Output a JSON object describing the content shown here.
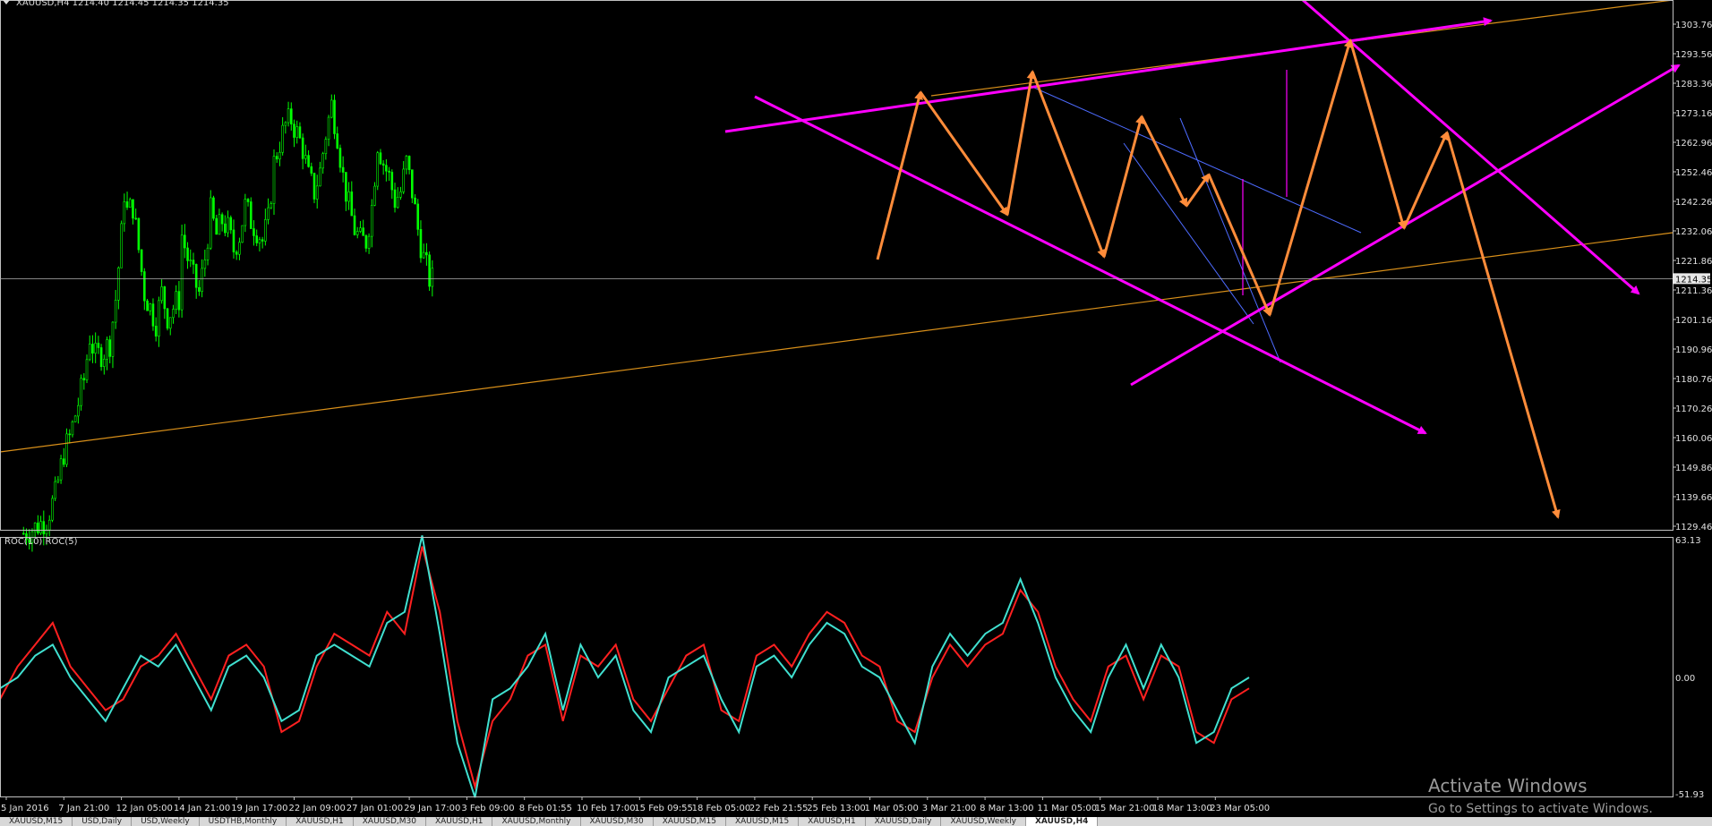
{
  "main_panel": {
    "header": "XAUUSD,H4  1214.40 1214.45 1214.35 1214.35",
    "price_ticks": [
      "1303.76",
      "1293.56",
      "1283.36",
      "1273.16",
      "1262.96",
      "1252.46",
      "1242.26",
      "1232.06",
      "1221.86",
      "1211.36",
      "1201.16",
      "1190.96",
      "1180.76",
      "1170.26",
      "1160.06",
      "1149.86",
      "1139.66",
      "1129.46"
    ],
    "current_price_label": "1214.35"
  },
  "indicator_panel": {
    "header": "ROC(10)  ROC(5)",
    "ticks": [
      "63.13",
      "0.00",
      "-51.93"
    ]
  },
  "time_axis": [
    "5 Jan 2016",
    "7 Jan 21:00",
    "12 Jan 05:00",
    "14 Jan 21:00",
    "19 Jan 17:00",
    "22 Jan 09:00",
    "27 Jan 01:00",
    "29 Jan 17:00",
    "3 Feb 09:00",
    "8 Feb 01:55",
    "10 Feb 17:00",
    "15 Feb 09:55",
    "18 Feb 05:00",
    "22 Feb 21:55",
    "25 Feb 13:00",
    "1 Mar 05:00",
    "3 Mar 21:00",
    "8 Mar 13:00",
    "11 Mar 05:00",
    "15 Mar 21:00",
    "18 Mar 13:00",
    "23 Mar 05:00"
  ],
  "colors": {
    "candle": "#00ff00",
    "channel": "#ff00ff",
    "zigzag": "#ff8c3a",
    "trendline": "#d9901a",
    "bluelines": "#4d6bff",
    "roc10": "#ff2020",
    "roc5": "#40e0d0"
  },
  "tabs": [
    "XAUUSD,M15",
    "USD,Daily",
    "USD,Weekly",
    "USDTHB,Monthly",
    "XAUUSD,H1",
    "XAUUSD,M30",
    "XAUUSD,H1",
    "XAUUSD,Monthly",
    "XAUUSD,M30",
    "XAUUSD,M15",
    "XAUUSD,M15",
    "XAUUSD,H1",
    "XAUUSD,Daily",
    "XAUUSD,Weekly",
    "XAUUSD,H4"
  ],
  "watermark": {
    "line1": "Activate Windows",
    "line2": "Go to Settings to activate Windows."
  },
  "chart_data": [
    {
      "type": "candlestick",
      "title": "XAUUSD,H4",
      "ylim": [
        1129.46,
        1308.0
      ],
      "x": [
        "5 Jan 2016",
        "7 Jan 21:00",
        "12 Jan 05:00",
        "14 Jan 21:00",
        "19 Jan 17:00",
        "22 Jan 09:00",
        "27 Jan 01:00",
        "29 Jan 17:00",
        "3 Feb 09:00",
        "8 Feb 01:55",
        "10 Feb 17:00",
        "15 Feb 09:55",
        "18 Feb 05:00",
        "22 Feb 21:55",
        "25 Feb 13:00",
        "1 Mar 05:00",
        "3 Mar 21:00",
        "8 Mar 13:00",
        "11 Mar 05:00",
        "15 Mar 21:00",
        "18 Mar 13:00",
        "23 Mar 05:00"
      ],
      "close_path": [
        [
          0.3,
          1127
        ],
        [
          0.5,
          1129
        ],
        [
          0.7,
          1132
        ],
        [
          0.85,
          1140
        ],
        [
          1.0,
          1155
        ],
        [
          1.1,
          1160
        ],
        [
          1.2,
          1168
        ],
        [
          1.35,
          1180
        ],
        [
          1.45,
          1195
        ],
        [
          1.55,
          1188
        ],
        [
          1.7,
          1190
        ],
        [
          1.8,
          1193
        ],
        [
          1.9,
          1208
        ],
        [
          2.0,
          1230
        ],
        [
          2.05,
          1245
        ],
        [
          2.1,
          1238
        ],
        [
          2.2,
          1240
        ],
        [
          2.3,
          1225
        ],
        [
          2.4,
          1210
        ],
        [
          2.5,
          1205
        ],
        [
          2.6,
          1200
        ],
        [
          2.7,
          1210
        ],
        [
          2.8,
          1202
        ],
        [
          2.9,
          1205
        ],
        [
          3.0,
          1208
        ],
        [
          3.05,
          1230
        ],
        [
          3.15,
          1222
        ],
        [
          3.25,
          1215
        ],
        [
          3.35,
          1210
        ],
        [
          3.45,
          1222
        ],
        [
          3.55,
          1238
        ],
        [
          3.65,
          1230
        ],
        [
          3.75,
          1235
        ],
        [
          3.85,
          1232
        ],
        [
          3.95,
          1225
        ],
        [
          4.05,
          1230
        ],
        [
          4.15,
          1240
        ],
        [
          4.25,
          1235
        ],
        [
          4.35,
          1232
        ],
        [
          4.45,
          1228
        ],
        [
          4.55,
          1235
        ],
        [
          4.65,
          1255
        ],
        [
          4.75,
          1262
        ],
        [
          4.85,
          1268
        ],
        [
          4.95,
          1270
        ],
        [
          5.05,
          1265
        ],
        [
          5.15,
          1260
        ],
        [
          5.25,
          1250
        ],
        [
          5.35,
          1245
        ],
        [
          5.45,
          1252
        ],
        [
          5.55,
          1265
        ],
        [
          5.65,
          1275
        ],
        [
          5.75,
          1265
        ],
        [
          5.85,
          1250
        ],
        [
          5.95,
          1240
        ],
        [
          6.05,
          1232
        ],
        [
          6.15,
          1228
        ],
        [
          6.25,
          1228
        ],
        [
          6.35,
          1240
        ],
        [
          6.45,
          1262
        ],
        [
          6.55,
          1255
        ],
        [
          6.65,
          1250
        ],
        [
          6.75,
          1242
        ],
        [
          6.85,
          1245
        ],
        [
          6.95,
          1255
        ],
        [
          7.05,
          1245
        ],
        [
          7.15,
          1232
        ],
        [
          7.25,
          1222
        ],
        [
          7.35,
          1215
        ],
        [
          7.45,
          1214
        ]
      ],
      "series": [
        {
          "name": "ROC(10)",
          "values": [
            -10,
            5,
            15,
            25,
            5,
            -5,
            -15,
            -10,
            5,
            10,
            20,
            5,
            -10,
            10,
            15,
            5,
            -25,
            -20,
            5,
            20,
            15,
            10,
            30,
            20,
            60,
            30,
            -20,
            -50,
            -20,
            -10,
            10,
            15,
            -20,
            10,
            5,
            15,
            -10,
            -20,
            -5,
            10,
            15,
            -15,
            -20,
            10,
            15,
            5,
            20,
            30,
            25,
            10,
            5,
            -20,
            -25,
            0,
            15,
            5,
            15,
            20,
            40,
            30,
            5,
            -10,
            -20,
            5,
            10,
            -10,
            10,
            5,
            -25,
            -30,
            -10,
            -5
          ]
        },
        {
          "name": "ROC(5)",
          "values": [
            -5,
            0,
            10,
            15,
            0,
            -10,
            -20,
            -5,
            10,
            5,
            15,
            0,
            -15,
            5,
            10,
            0,
            -20,
            -15,
            10,
            15,
            10,
            5,
            25,
            30,
            65,
            20,
            -30,
            -55,
            -10,
            -5,
            5,
            20,
            -15,
            15,
            0,
            10,
            -15,
            -25,
            0,
            5,
            10,
            -10,
            -25,
            5,
            10,
            0,
            15,
            25,
            20,
            5,
            0,
            -15,
            -30,
            5,
            20,
            10,
            20,
            25,
            45,
            25,
            0,
            -15,
            -25,
            0,
            15,
            -5,
            15,
            0,
            -30,
            -25,
            -5,
            0
          ]
        }
      ]
    }
  ]
}
